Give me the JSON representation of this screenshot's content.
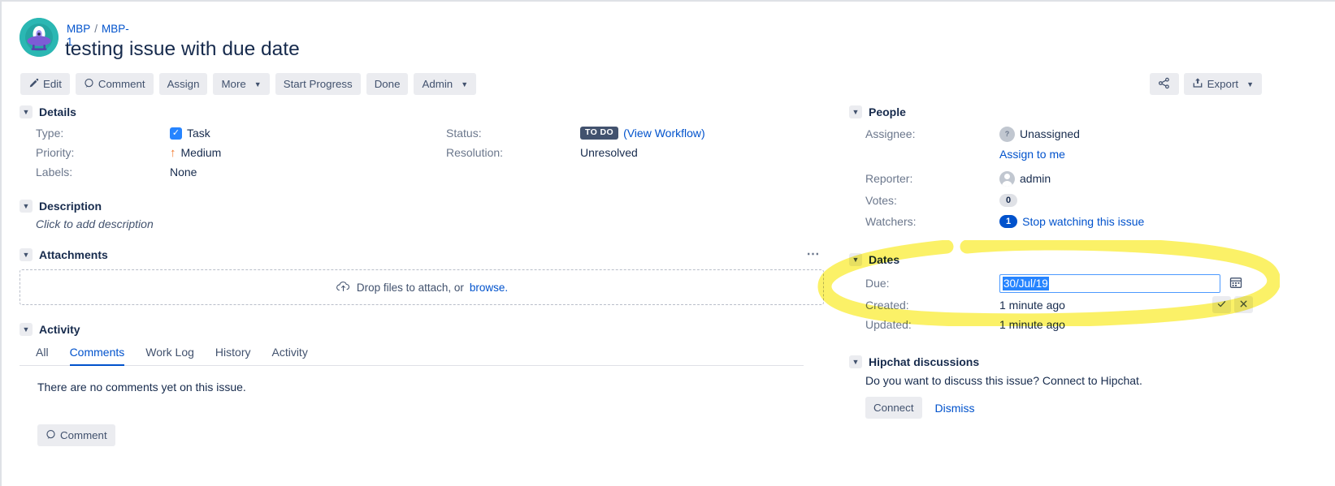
{
  "header": {
    "breadcrumb": {
      "project": "MBP",
      "separator": "/",
      "issue_key": "MBP-1"
    },
    "title": "testing issue with due date",
    "avatar_icon": "ufo-avatar-icon"
  },
  "toolbar": {
    "edit": "Edit",
    "comment": "Comment",
    "assign": "Assign",
    "more": "More",
    "start_progress": "Start Progress",
    "done": "Done",
    "admin": "Admin",
    "share_icon": "share-icon",
    "export": "Export"
  },
  "details": {
    "heading": "Details",
    "type_label": "Type:",
    "type_value": "Task",
    "priority_label": "Priority:",
    "priority_value": "Medium",
    "labels_label": "Labels:",
    "labels_value": "None",
    "status_label": "Status:",
    "status_value": "TO DO",
    "view_workflow": "(View Workflow)",
    "resolution_label": "Resolution:",
    "resolution_value": "Unresolved"
  },
  "description": {
    "heading": "Description",
    "placeholder": "Click to add description"
  },
  "attachments": {
    "heading": "Attachments",
    "menu_icon": "more-options-icon",
    "drop_text": "Drop files to attach, or",
    "browse_link": "browse.",
    "upload_icon": "cloud-upload-icon"
  },
  "activity": {
    "heading": "Activity",
    "tabs": [
      {
        "label": "All",
        "active": false
      },
      {
        "label": "Comments",
        "active": true
      },
      {
        "label": "Work Log",
        "active": false
      },
      {
        "label": "History",
        "active": false
      },
      {
        "label": "Activity",
        "active": false
      }
    ],
    "empty_text": "There are no comments yet on this issue.",
    "comment_button": "Comment"
  },
  "people": {
    "heading": "People",
    "assignee_label": "Assignee:",
    "assignee_value": "Unassigned",
    "assign_to_me": "Assign to me",
    "reporter_label": "Reporter:",
    "reporter_value": "admin",
    "votes_label": "Votes:",
    "votes_value": "0",
    "watchers_label": "Watchers:",
    "watchers_count": "1",
    "watchers_action": "Stop watching this issue"
  },
  "dates": {
    "heading": "Dates",
    "due_label": "Due:",
    "due_value": "30/Jul/19",
    "calendar_icon": "calendar-icon",
    "confirm_icon": "check-icon",
    "cancel_icon": "cross-icon",
    "created_label": "Created:",
    "created_value": "1 minute ago",
    "updated_label": "Updated:",
    "updated_value": "1 minute ago"
  },
  "hipchat": {
    "heading": "Hipchat discussions",
    "text": "Do you want to discuss this issue? Connect to Hipchat.",
    "connect": "Connect",
    "dismiss": "Dismiss"
  },
  "annotation": {
    "type": "highlighter-oval",
    "color": "#fdf157"
  }
}
